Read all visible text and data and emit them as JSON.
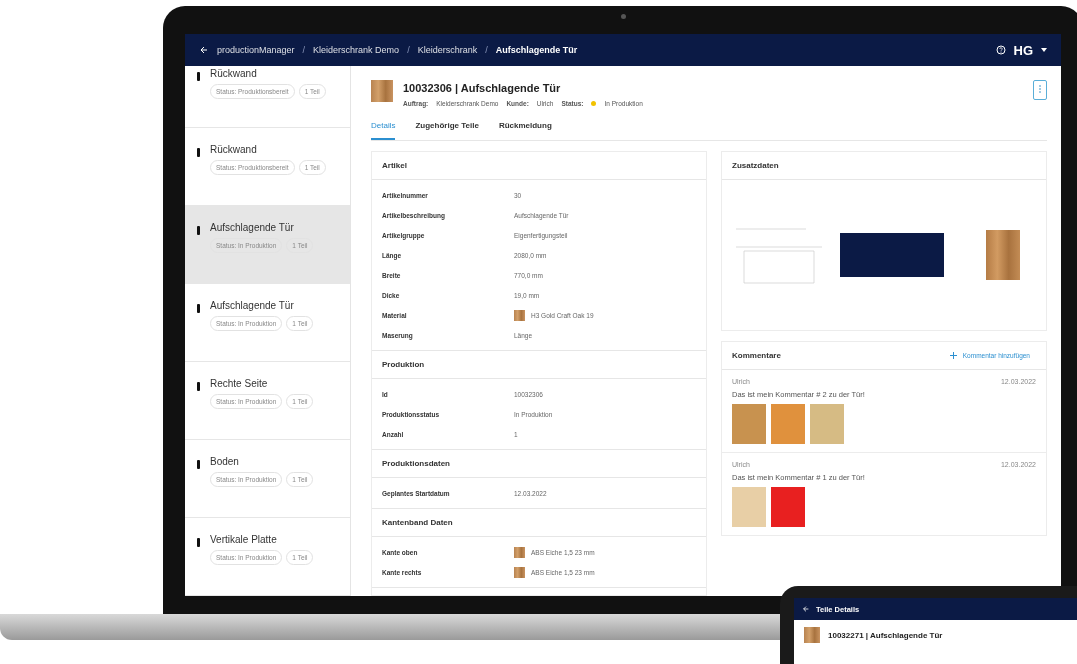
{
  "topbar": {
    "separator": "/",
    "breadcrumbs": [
      {
        "label": "productionManager",
        "current": false
      },
      {
        "label": "Kleiderschrank Demo",
        "current": false
      },
      {
        "label": "Kleiderschrank",
        "current": false
      },
      {
        "label": "Aufschlagende Tür",
        "current": true
      }
    ],
    "logo": "HG"
  },
  "sidebar": {
    "items": [
      {
        "name": "Rückwand",
        "status": "Status: Produktionsbereit",
        "count": "1 Teil",
        "selected": false
      },
      {
        "name": "Rückwand",
        "status": "Status: Produktionsbereit",
        "count": "1 Teil",
        "selected": false
      },
      {
        "name": "Aufschlagende Tür",
        "status": "Status: In Produktion",
        "count": "1 Teil",
        "selected": true
      },
      {
        "name": "Aufschlagende Tür",
        "status": "Status: In Produktion",
        "count": "1 Teil",
        "selected": false
      },
      {
        "name": "Rechte Seite",
        "status": "Status: In Produktion",
        "count": "1 Teil",
        "selected": false
      },
      {
        "name": "Boden",
        "status": "Status: In Produktion",
        "count": "1 Teil",
        "selected": false
      },
      {
        "name": "Vertikale Platte",
        "status": "Status: In Produktion",
        "count": "1 Teil",
        "selected": false
      }
    ]
  },
  "header": {
    "title": "10032306 | Aufschlagende Tür",
    "meta": [
      {
        "label": "Auftrag:",
        "value": "Kleiderschrank Demo"
      },
      {
        "label": "Kunde:",
        "value": "Ulrich"
      },
      {
        "label": "Status:",
        "value": "In Produktion",
        "color": "#f2c200"
      }
    ]
  },
  "tabs": [
    {
      "label": "Details",
      "selected": true
    },
    {
      "label": "Zugehörige Teile",
      "selected": false
    },
    {
      "label": "Rückmeldung",
      "selected": false
    }
  ],
  "sections": [
    {
      "title": "Artikel",
      "rows": [
        {
          "label": "Artikelnummer",
          "value": "30",
          "kind": "text"
        },
        {
          "label": "Artikelbeschreibung",
          "value": "Aufschlagende Tür",
          "kind": "text"
        },
        {
          "label": "Artikelgruppe",
          "value": "Eigenfertigungsteil",
          "kind": "text"
        },
        {
          "label": "Länge",
          "value": "2080,0 mm",
          "kind": "text"
        },
        {
          "label": "Breite",
          "value": "770,0 mm",
          "kind": "text"
        },
        {
          "label": "Dicke",
          "value": "19,0 mm",
          "kind": "text"
        },
        {
          "label": "Material",
          "value": "H3 Gold Craft Oak 19",
          "kind": "swatch"
        },
        {
          "label": "Maserung",
          "value": "Länge",
          "kind": "text"
        }
      ]
    },
    {
      "title": "Produktion",
      "rows": [
        {
          "label": "Id",
          "value": "10032306",
          "kind": "text"
        },
        {
          "label": "Produktionsstatus",
          "value": "In Produktion",
          "kind": "text"
        },
        {
          "label": "Anzahl",
          "value": "1",
          "kind": "text"
        }
      ]
    },
    {
      "title": "Produktionsdaten",
      "rows": [
        {
          "label": "Geplantes Startdatum",
          "value": "12.03.2022",
          "kind": "text"
        }
      ]
    },
    {
      "title": "Kantenband Daten",
      "rows": [
        {
          "label": "Kante oben",
          "value": "ABS Eiche 1,5 23 mm",
          "kind": "swatch"
        },
        {
          "label": "Kante rechts",
          "value": "ABS Eiche 1,5 23 mm",
          "kind": "swatch"
        }
      ]
    }
  ],
  "extra": {
    "title": "Zusatzdaten"
  },
  "comments": {
    "title": "Kommentare",
    "add": "Kommentar hinzufügen",
    "items": [
      {
        "author": "Ulrich",
        "date": "12.03.2022",
        "text": "Das ist mein Kommentar # 2 zu der Tür!",
        "images": [
          {
            "color": "#c8924f"
          },
          {
            "color": "#e0913d"
          },
          {
            "color": "#d6bb84"
          }
        ]
      },
      {
        "author": "Ulrich",
        "date": "12.03.2022",
        "text": "Das ist mein Kommentar # 1 zu der Tür!",
        "images": [
          {
            "color": "#e8cfa6"
          },
          {
            "color": "#e82020"
          }
        ]
      }
    ]
  },
  "phone": {
    "title": "Teile Details",
    "heading": "10032271 | Aufschlagende Tür"
  }
}
